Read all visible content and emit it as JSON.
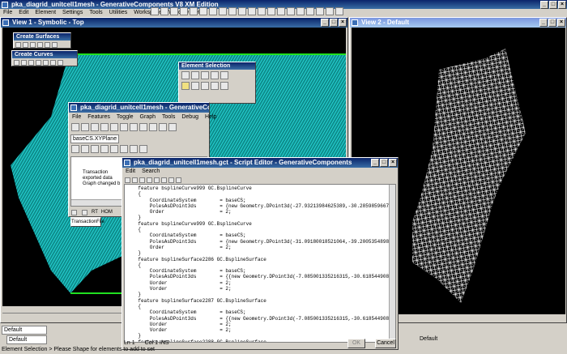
{
  "app": {
    "title": "pka_diagrid_unitcell1mesh - GenerativeComponents V8 XM Edition",
    "menu": [
      "File",
      "Edit",
      "Element",
      "Settings",
      "Tools",
      "Utilities",
      "Workspace",
      "Window",
      "Help"
    ]
  },
  "view1": {
    "title": "View 1 - Symbolic - Top"
  },
  "view2": {
    "title": "View 2 - Default"
  },
  "create_surfaces": {
    "title": "Create Surfaces"
  },
  "create_curves": {
    "title": "Create Curves"
  },
  "element_selection": {
    "title": "Element Selection"
  },
  "gc_window": {
    "title": "pka_diagrid_unitcell1mesh - GenerativeComponents",
    "menu": [
      "File",
      "Features",
      "Toggle",
      "Graph",
      "Tools",
      "Debug",
      "Help"
    ],
    "base_cs": "baseCS.XYPlane",
    "rows": [
      "Transaction",
      "exported data",
      "Graph changed b"
    ],
    "tab": "TransactionFile",
    "mode_label": "RT",
    "mode_value": "HOM"
  },
  "script_editor": {
    "title": "pka_diagrid_unitcell1mesh.gct - Script Editor - GenerativeComponents",
    "menu": [
      "Edit",
      "Search"
    ],
    "lines": [
      "    feature bsplineCurve999 GC.BsplineCurve",
      "    {",
      "        CoordinateSystem        = baseCS;",
      "        PolesAsDPoint3ds        = {new Geometry.DPoint3d(-27.93213984625389,-30.28598596673824,",
      "        Order                   = 2;",
      "    }",
      "    feature bsplineCurve999 GC.BsplineCurve",
      "    {",
      "        CoordinateSystem        = baseCS;",
      "        PolesAsDPoint3ds        = {new Geometry.DPoint3d(-31.09180018521064,-39.20053548984297,",
      "        Order                   = 2;",
      "    }",
      "    feature bsplineSurface2286 GC.BsplineSurface",
      "    {",
      "        CoordinateSystem        = baseCS;",
      "        PolesAsDPoint3ds        = {{new Geometry.DPoint3d(-7.085001335216315,-30.61854490857998",
      "        Uorder                  = 2;",
      "        Vorder                  = 2;",
      "    }",
      "    feature bsplineSurface2287 GC.BsplineSurface",
      "    {",
      "        CoordinateSystem        = baseCS;",
      "        PolesAsDPoint3ds        = {{new Geometry.DPoint3d(-7.085001335216315,-30.61854490857998",
      "        Uorder                  = 2;",
      "        Vorder                  = 2;",
      "    }",
      "    feature bsplineSurface2288 GC.BsplineSurface",
      "    {"
    ],
    "status_ln": "Ln 1",
    "status_col": "Col 1  INS",
    "ok": "OK",
    "cancel": "Cancel"
  },
  "bottom": {
    "level1": "Default",
    "level2": "Default",
    "level_right": "Default",
    "status": "Element Selection > Please Shape for elements to add to set"
  },
  "colors": {
    "cyan_mesh": "#17d7d7",
    "green_edge": "#20e020",
    "view_bg": "#000000"
  }
}
